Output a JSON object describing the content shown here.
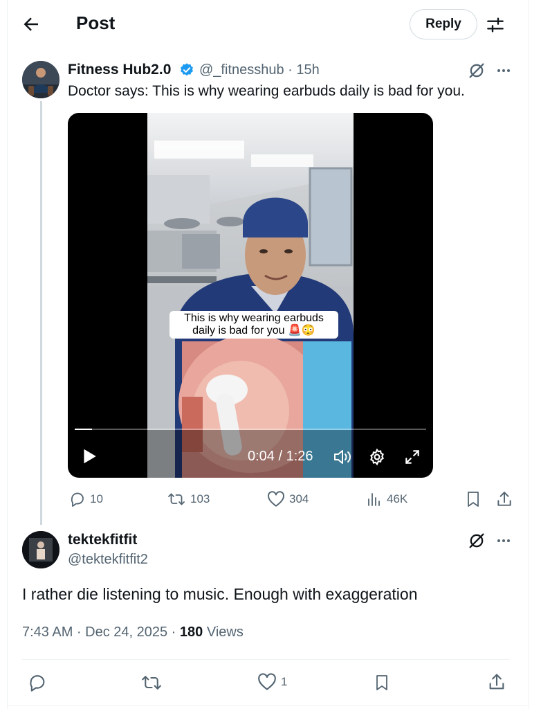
{
  "header": {
    "title": "Post",
    "reply_label": "Reply"
  },
  "tweet": {
    "display_name": "Fitness Hub2.0",
    "handle_time": "@_fitnesshub · 15h",
    "text": "Doctor says: This is why wearing earbuds daily is bad for you.",
    "video": {
      "caption_line1": "This is why wearing earbuds",
      "caption_line2": "daily is bad for you 🚨😳",
      "time": "0:04 / 1:26",
      "progress_fraction": 0.05
    },
    "stats": {
      "replies": "10",
      "reposts": "103",
      "likes": "304",
      "views": "46K"
    }
  },
  "reply": {
    "display_name": "tektekfitfit",
    "handle": "@tektekfitfit2",
    "text": "I rather die listening to music. Enough with exaggeration",
    "timestamp": "7:43 AM · Dec 24, 2025 · ",
    "views_count": "180",
    "views_label": " Views",
    "likes": "1"
  },
  "colors": {
    "verified": "#1d9bf0",
    "text": "#0f1419",
    "secondary": "#536471",
    "border": "#cfd9de"
  }
}
